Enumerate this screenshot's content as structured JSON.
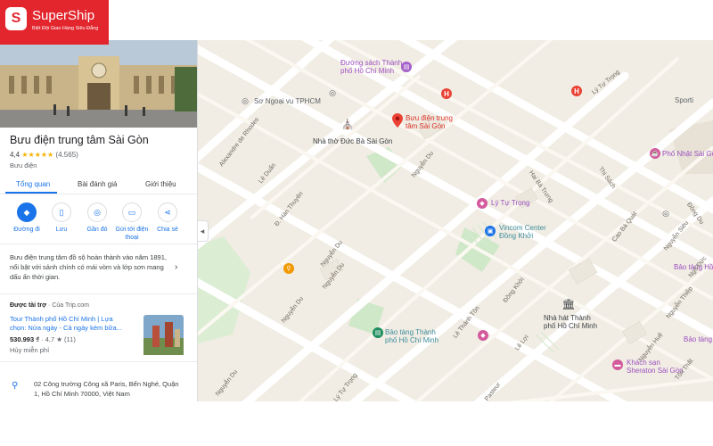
{
  "brand": {
    "name": "SuperShip",
    "tagline": "Biệt Đội Giao Hàng Siêu Đẳng"
  },
  "place": {
    "name": "Bưu điện trung tâm Sài Gòn",
    "rating": "4,4",
    "stars": "★★★★★",
    "reviews": "(4.565)",
    "category": "Bưu điện",
    "tabs": [
      "Tổng quan",
      "Bài đánh giá",
      "Giới thiệu"
    ],
    "actions": [
      {
        "label": "Đường đi",
        "icon": "directions-icon"
      },
      {
        "label": "Lưu",
        "icon": "bookmark-icon"
      },
      {
        "label": "Gần đó",
        "icon": "nearby-icon"
      },
      {
        "label": "Gửi tới điện thoại",
        "label1": "Gửi tới điện",
        "label2": "thoại",
        "icon": "send-to-phone-icon"
      },
      {
        "label": "Chia sẻ",
        "icon": "share-icon"
      }
    ],
    "description": "Bưu điện trung tâm đồ sộ hoàn thành vào năm 1891, nổi bật với sảnh chính có mái vòm và lớp sơn mang dấu ấn thời gian.",
    "sponsored": {
      "title": "Được tài trợ",
      "source": "· Của Trip.com",
      "link_line1": "Tour Thành phố Hồ Chí Minh | Lựa",
      "link_line2": "chọn: Nửa ngày - Cả ngày kèm bữa...",
      "price": "530.993 ₫",
      "rating": "· 4,7 ★ (11)",
      "cancel": "Hủy miễn phí"
    },
    "address_line1": "02 Công trường Công xã Paris, Bến Nghé, Quận",
    "address_line2": "1, Hồ Chí Minh 70000, Việt Nam"
  },
  "map": {
    "labels": {
      "book_street_1": "Đường sách Thành",
      "book_street_2": "phố Hồ Chí Minh",
      "seagull": "Sơ Ngoại vụ TPHCM",
      "cathedral": "Nhà thờ Đức Bà Sài Gòn",
      "post_office_1": "Bưu điện trung",
      "post_office_2": "tâm Sài Gòn",
      "ly_tu_trong_place": "Lý Tự Trọng",
      "vincom_1": "Vincom Center",
      "vincom_2": "Đồng Khởi",
      "pho_nhat": "Phố Nhật Sài Gòn",
      "opera_1": "Nhà hát Thành",
      "opera_2": "phố Hồ Chí Minh",
      "museum_hcm_1": "Bảo tàng Thành",
      "museum_hcm_2": "phố Hồ Chí Minh",
      "sheraton_1": "Khách sạn",
      "sheraton_2": "Sheraton Sài Gòn",
      "museum_right_1": "Bảo tàng Hồ",
      "museum_right_2": "Bảo tàng",
      "sports": "Sporti"
    },
    "streets": {
      "alexandre": "Alexandre de Rhodes",
      "le_duan": "Lê Duẩn",
      "han_thuyen": "Đ. Hàn Thuyên",
      "nguyen_du_1": "Nguyễn Du",
      "nguyen_du_2": "Nguyễn Du",
      "nguyen_du_3": "Nguyễn Du",
      "nguyen_du_4": "Nguyễn Du",
      "ly_tu_trong_1": "Lý Tự Trọng",
      "ly_tu_trong_2": "Lý Tự Trọng",
      "le_thanh_ton": "Lê Thánh Tôn",
      "dong_khoi": "Đồng Khởi",
      "le_loi": "Lê Lợi",
      "pasteur": "Pasteur",
      "hai_ba_trung": "Hai Bà Trưng",
      "thi_sach": "Thi Sách",
      "cao_ba_quat": "Cao Bá Quát",
      "nguyen_sieu": "Nguyễn Siêu",
      "nguyen_hue": "Nguyễn Huệ",
      "dong_du": "Đông Du",
      "nguyen_thiep": "Nguyễn Thiệp",
      "ton_that": "Tôn Thất",
      "ngo_duc": "Ngô Đức"
    }
  }
}
